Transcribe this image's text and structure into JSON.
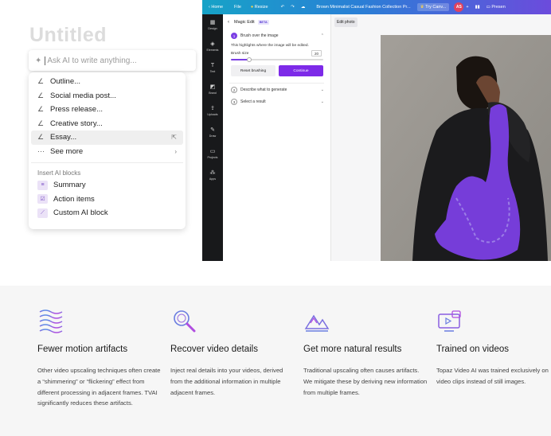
{
  "writer": {
    "doc_title": "Untitled",
    "ask_placeholder": "Ask AI to write anything...",
    "menu_items": [
      {
        "label": "Outline..."
      },
      {
        "label": "Social media post..."
      },
      {
        "label": "Press release..."
      },
      {
        "label": "Creative story..."
      },
      {
        "label": "Essay..."
      },
      {
        "label": "See more"
      }
    ],
    "blocks_heading": "Insert AI blocks",
    "blocks": [
      {
        "label": "Summary"
      },
      {
        "label": "Action items"
      },
      {
        "label": "Custom AI block"
      }
    ]
  },
  "canva": {
    "topbar": {
      "home": "Home",
      "file": "File",
      "resize": "Resize",
      "doc_title": "Brown Minimalist Casual Fashion Collection Pr...",
      "try": "Try Canv...",
      "avatar": "AS",
      "present": "Presen"
    },
    "sidebar": [
      {
        "label": "Design",
        "icon": "layout-icon"
      },
      {
        "label": "Elements",
        "icon": "shapes-icon"
      },
      {
        "label": "Text",
        "icon": "text-icon"
      },
      {
        "label": "Brand",
        "icon": "brand-icon"
      },
      {
        "label": "Uploads",
        "icon": "upload-icon"
      },
      {
        "label": "Draw",
        "icon": "pen-icon"
      },
      {
        "label": "Projects",
        "icon": "folder-icon"
      },
      {
        "label": "Apps",
        "icon": "apps-icon"
      }
    ],
    "panel": {
      "title": "Magic Edit",
      "badge": "BETA",
      "step1_num": "1",
      "step1": "Brush over the image",
      "hint": "This highlights where the image will be edited.",
      "brush_label": "Brush size",
      "brush_value": "20",
      "brush_fraction": 0.2,
      "reset": "Reset brushing",
      "continue": "Continue",
      "step2_num": "2",
      "step2": "Describe what to generate",
      "step3_num": "3",
      "step3": "Select a result"
    },
    "edit_photo": "Edit photo",
    "colors": {
      "accent": "#7d2ae8",
      "mask": "#7b3fe4"
    }
  },
  "features": [
    {
      "title": "Fewer motion artifacts",
      "icon": "waves-icon",
      "desc": "Other video upscaling techniques often create a “shimmering” or “flickering” effect from different processing in adjacent frames. TVAI significantly reduces these artifacts."
    },
    {
      "title": "Recover video details",
      "icon": "magnifier-icon",
      "desc": "Inject real details into your videos, derived from the additional information in multiple adjacent frames."
    },
    {
      "title": "Get more natural results",
      "icon": "mountains-icon",
      "desc": "Traditional upscaling often causes artifacts. We mitigate these by deriving new information from multiple frames."
    },
    {
      "title": "Trained on videos",
      "icon": "video-screen-icon",
      "desc": "Topaz Video AI was trained exclusively on video clips instead of still images."
    }
  ]
}
